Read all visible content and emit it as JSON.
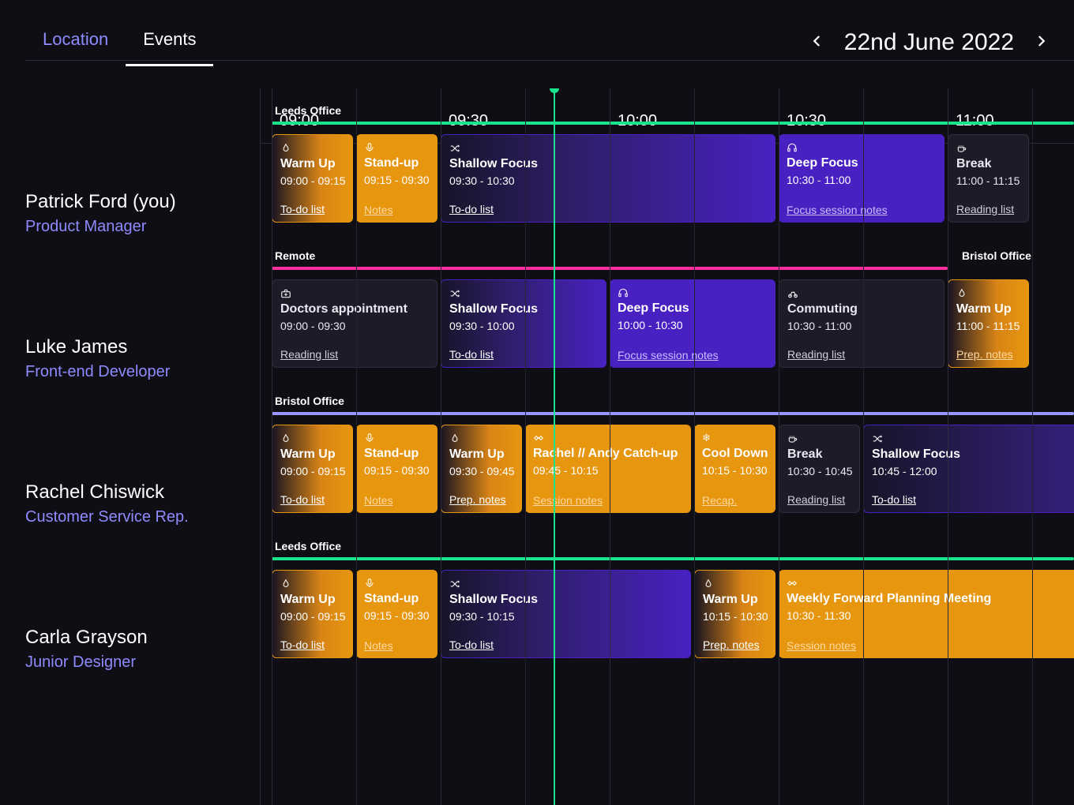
{
  "header": {
    "tabs": {
      "location": "Location",
      "events": "Events"
    },
    "date": "22nd June 2022"
  },
  "time_slots": [
    "09:00",
    "09:30",
    "10:00",
    "10:30",
    "11:00"
  ],
  "colors": {
    "green": "#19e38c",
    "pink": "#ff2fa0",
    "lilac": "#9a96ff",
    "orange": "#e6960f",
    "purple": "#4921c2"
  },
  "people": [
    {
      "name": "Patrick Ford (you)",
      "role": "Product Manager",
      "location": "Leeds Office",
      "location_color": "green",
      "events": [
        {
          "icon": "flame",
          "title": "Warm Up",
          "time": "09:00 - 09:15",
          "link": "To-do list",
          "palette": "orange-grad",
          "linkcls": "lwhite"
        },
        {
          "icon": "mic",
          "title": "Stand-up",
          "time": "09:15 - 09:30",
          "link": "Notes",
          "palette": "orange-solid",
          "linkcls": "lorange"
        },
        {
          "icon": "shuffle",
          "title": "Shallow Focus",
          "time": "09:30 - 10:30",
          "link": "To-do list",
          "palette": "purple-grad",
          "linkcls": "lwhite"
        },
        {
          "icon": "headphones",
          "title": "Deep Focus",
          "time": "10:30 - 11:00",
          "link": "Focus session notes",
          "palette": "purple-solid",
          "linkcls": "lpurple"
        },
        {
          "icon": "cup",
          "title": "Break",
          "time": "11:00 - 11:15",
          "link": "Reading list",
          "palette": "dark",
          "linkcls": "lgrey"
        }
      ]
    },
    {
      "name": "Luke James",
      "role": "Front-end Developer",
      "location": "Remote",
      "location_color": "pink",
      "extra_location": "Bristol Office",
      "events": [
        {
          "icon": "medkit",
          "title": "Doctors appointment",
          "time": "09:00 - 09:30",
          "link": "Reading list",
          "palette": "dark",
          "linkcls": "lgrey"
        },
        {
          "icon": "shuffle",
          "title": "Shallow Focus",
          "time": "09:30 - 10:00",
          "link": "To-do list",
          "palette": "purple-grad",
          "linkcls": "lwhite"
        },
        {
          "icon": "headphones",
          "title": "Deep Focus",
          "time": "10:00 - 10:30",
          "link": "Focus session notes",
          "palette": "purple-solid",
          "linkcls": "lpurple"
        },
        {
          "icon": "bike",
          "title": "Commuting",
          "time": "10:30 - 11:00",
          "link": "Reading list",
          "palette": "dark",
          "linkcls": "lgrey"
        },
        {
          "icon": "flame",
          "title": "Warm Up",
          "time": "11:00 - 11:15",
          "link": "Prep. notes",
          "palette": "orange-grad",
          "linkcls": "lorange"
        }
      ]
    },
    {
      "name": "Rachel Chiswick",
      "role": "Customer Service Rep.",
      "location": "Bristol Office",
      "location_color": "lilac",
      "events": [
        {
          "icon": "flame",
          "title": "Warm Up",
          "time": "09:00 - 09:15",
          "link": "To-do list",
          "palette": "orange-grad",
          "linkcls": "lwhite"
        },
        {
          "icon": "mic",
          "title": "Stand-up",
          "time": "09:15 - 09:30",
          "link": "Notes",
          "palette": "orange-solid",
          "linkcls": "lorange"
        },
        {
          "icon": "flame",
          "title": "Warm Up",
          "time": "09:30 - 09:45",
          "link": "Prep. notes",
          "palette": "orange-grad",
          "linkcls": "lwhite"
        },
        {
          "icon": "handshake",
          "title": "Rachel // Andy Catch-up",
          "time": "09:45 - 10:15",
          "link": "Session notes",
          "palette": "orange-solid",
          "linkcls": "lorange"
        },
        {
          "icon": "snowflake",
          "title": "Cool Down",
          "time": "10:15 - 10:30",
          "link": "Recap.",
          "palette": "orange-solid",
          "linkcls": "lorange"
        },
        {
          "icon": "cup",
          "title": "Break",
          "time": "10:30 - 10:45",
          "link": "Reading list",
          "palette": "dark",
          "linkcls": "lgrey"
        },
        {
          "icon": "shuffle",
          "title": "Shallow Focus",
          "time": "10:45 - 12:00",
          "link": "To-do list",
          "palette": "purple-grad",
          "linkcls": "lwhite"
        }
      ]
    },
    {
      "name": "Carla Grayson",
      "role": "Junior Designer",
      "location": "Leeds Office",
      "location_color": "green",
      "events": [
        {
          "icon": "flame",
          "title": "Warm Up",
          "time": "09:00 - 09:15",
          "link": "To-do list",
          "palette": "orange-grad",
          "linkcls": "lwhite"
        },
        {
          "icon": "mic",
          "title": "Stand-up",
          "time": "09:15 - 09:30",
          "link": "Notes",
          "palette": "orange-solid",
          "linkcls": "lorange"
        },
        {
          "icon": "shuffle",
          "title": "Shallow Focus",
          "time": "09:30 - 10:15",
          "link": "To-do list",
          "palette": "purple-grad",
          "linkcls": "lwhite"
        },
        {
          "icon": "flame",
          "title": "Warm Up",
          "time": "10:15 - 10:30",
          "link": "Prep. notes",
          "palette": "orange-grad",
          "linkcls": "lwhite"
        },
        {
          "icon": "handshake",
          "title": "Weekly Forward Planning Meeting",
          "time": "10:30 - 11:30",
          "link": "Session notes",
          "palette": "orange-solid",
          "linkcls": "lorange"
        }
      ]
    }
  ]
}
